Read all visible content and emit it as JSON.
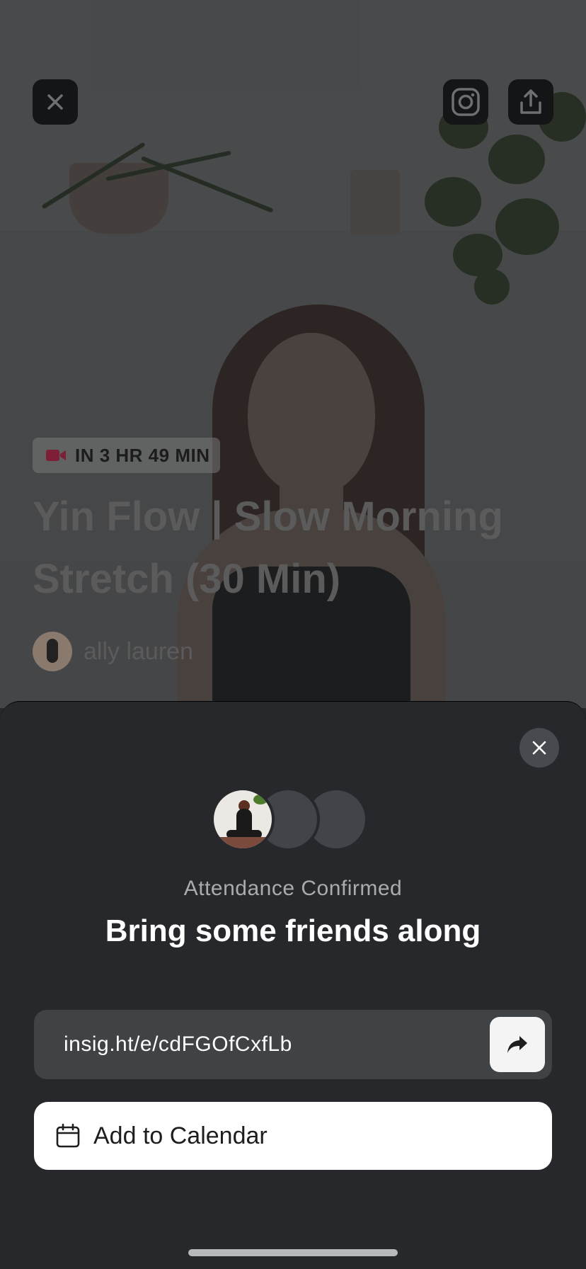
{
  "hero": {
    "badge": {
      "icon": "video-camera-icon",
      "text": "IN 3 HR 49 MIN",
      "icon_color": "#7d1f36"
    },
    "title": "Yin Flow | Slow Morning Stretch (30 Min)",
    "host_name": "ally lauren"
  },
  "top_actions": {
    "close": "close-icon",
    "instagram": "instagram-icon",
    "share": "share-icon"
  },
  "sheet": {
    "status": "Attendance Confirmed",
    "headline": "Bring some friends along",
    "link": {
      "value": "insig.ht/e/cdFGOfCxfLb",
      "button_icon": "forward-arrow-icon"
    },
    "calendar_button": {
      "icon": "calendar-icon",
      "label": "Add to Calendar"
    }
  },
  "colors": {
    "sheet_bg": "#26282b",
    "field_bg": "#3f4346",
    "button_bg": "#ffffff"
  }
}
